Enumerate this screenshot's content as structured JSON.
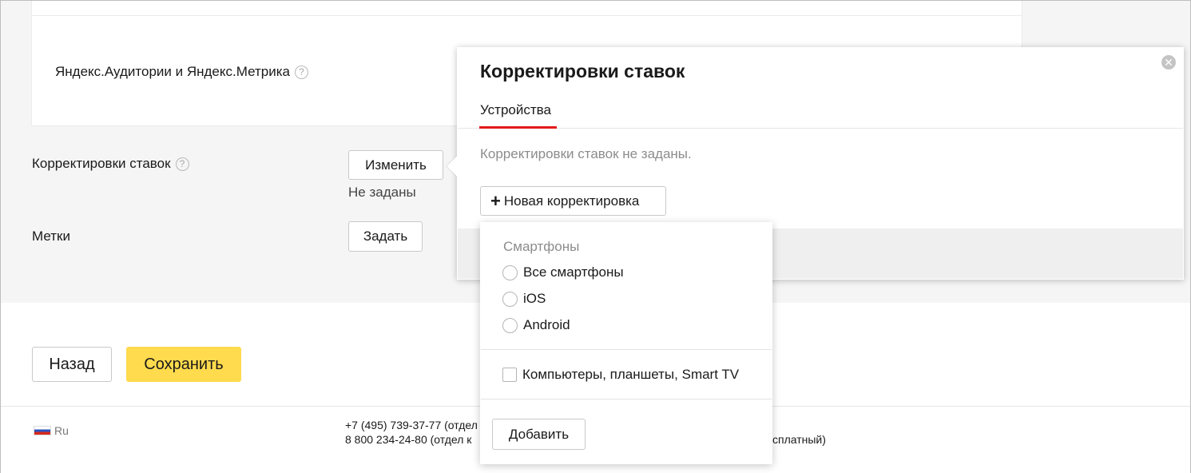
{
  "audiences": {
    "label": "Яндекс.Аудитории и Яндекс.Метрика"
  },
  "bid_adjustments": {
    "label": "Корректировки ставок",
    "button": "Изменить",
    "status": "Не заданы"
  },
  "tags": {
    "label": "Метки",
    "button": "Задать"
  },
  "help_icon_glyph": "?",
  "actions": {
    "back": "Назад",
    "save": "Сохранить"
  },
  "footer": {
    "language": "Ru",
    "phone_line_1": "+7 (495) 739-37-77 (отдел",
    "phone_line_2": "8 800 234-24-80 (отдел к",
    "phone_line_2_tail": "сплатный)"
  },
  "popup": {
    "title": "Корректировки ставок",
    "tab": "Устройства",
    "empty_message": "Корректировки ставок не заданы.",
    "new_adjustment": "Новая корректировка",
    "close_glyph": "✕",
    "plus_glyph": "+"
  },
  "dropdown": {
    "section_title": "Смартфоны",
    "radio_options": [
      "Все смартфоны",
      "iOS",
      "Android"
    ],
    "checkbox_option": "Компьютеры, планшеты, Smart TV",
    "add_button": "Добавить"
  },
  "colors": {
    "accent_yellow": "#ffdb4d",
    "tab_active_red": "#e21a1a"
  }
}
